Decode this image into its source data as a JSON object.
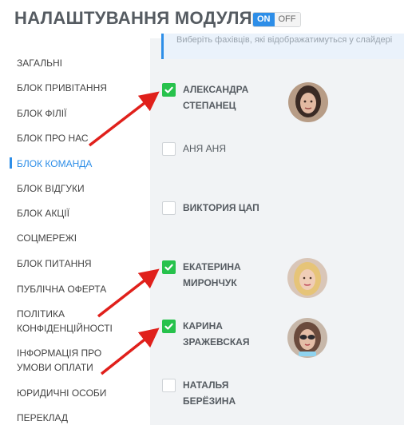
{
  "header": {
    "title": "НАЛАШТУВАННЯ МОДУЛЯ",
    "toggle_on": "ON",
    "toggle_off": "OFF"
  },
  "hint": "Виберіть фахівців, які відображатимуться у слайдері",
  "sidebar": {
    "items": [
      {
        "label": "ЗАГАЛЬНІ"
      },
      {
        "label": "БЛОК ПРИВІТАННЯ"
      },
      {
        "label": "БЛОК ФІЛІЇ"
      },
      {
        "label": "БЛОК ПРО НАС"
      },
      {
        "label": "БЛОК КОМАНДА",
        "active": true
      },
      {
        "label": "БЛОК ВІДГУКИ"
      },
      {
        "label": "БЛОК АКЦІЇ"
      },
      {
        "label": "СОЦМЕРЕЖІ"
      },
      {
        "label": "БЛОК ПИТАННЯ"
      },
      {
        "label": "ПУБЛІЧНА ОФЕРТА"
      },
      {
        "label": "ПОЛІТИКА КОНФІДЕНЦІЙНОСТІ"
      },
      {
        "label": "ІНФОРМАЦІЯ ПРО УМОВИ ОПЛАТИ"
      },
      {
        "label": "ЮРИДИЧНІ ОСОБИ"
      },
      {
        "label": "ПЕРЕКЛАД"
      }
    ]
  },
  "team": [
    {
      "name": "АЛЕКСАНДРА СТЕПАНЕЦ",
      "checked": true,
      "has_photo": true
    },
    {
      "name": "АНЯ АНЯ",
      "checked": false,
      "has_photo": false
    },
    {
      "name": "ВИКТОРИЯ ЦАП",
      "checked": false,
      "has_photo": false
    },
    {
      "name": "ЕКАТЕРИНА МИРОНЧУК",
      "checked": true,
      "has_photo": true
    },
    {
      "name": "КАРИНА ЗРАЖЕВСКАЯ",
      "checked": true,
      "has_photo": true
    },
    {
      "name": "НАТАЛЬЯ БЕРЁЗИНА",
      "checked": false,
      "has_photo": false
    }
  ],
  "colors": {
    "accent": "#2d8ee8",
    "checked": "#27c24c",
    "arrow": "#e0201b"
  }
}
